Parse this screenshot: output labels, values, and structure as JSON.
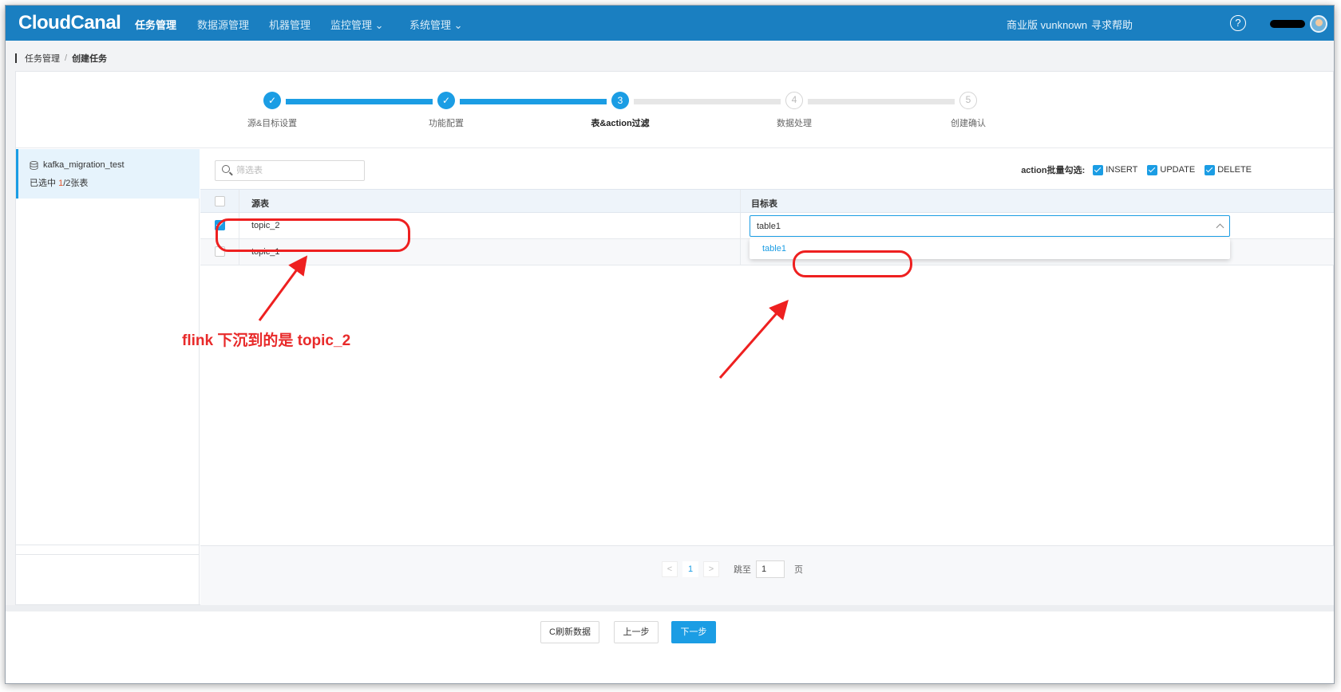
{
  "header": {
    "logo": "CloudCanal",
    "nav": [
      {
        "label": "任务管理",
        "active": true
      },
      {
        "label": "数据源管理",
        "active": false
      },
      {
        "label": "机器管理",
        "active": false
      },
      {
        "label": "监控管理 ⌄",
        "active": false
      },
      {
        "label": "系统管理 ⌄",
        "active": false
      }
    ],
    "edition": "商业版 vunknown",
    "help": "寻求帮助",
    "help_icon_glyph": "?"
  },
  "breadcrumb": {
    "root": "任务管理",
    "sep": "/",
    "current": "创建任务"
  },
  "steps": [
    {
      "label": "源&目标设置",
      "state": "done",
      "glyph": "✓"
    },
    {
      "label": "功能配置",
      "state": "done",
      "glyph": "✓"
    },
    {
      "label": "表&action过滤",
      "state": "current",
      "glyph": "3"
    },
    {
      "label": "数据处理",
      "state": "todo",
      "glyph": "4"
    },
    {
      "label": "创建确认",
      "state": "todo",
      "glyph": "5"
    }
  ],
  "left": {
    "db_name": "kafka_migration_test",
    "selected_prefix": "已选中 ",
    "selected_count": "1",
    "selected_suffix": "/2张表"
  },
  "filter": {
    "placeholder": "筛选表"
  },
  "action_batch": {
    "label": "action批量勾选:",
    "options": [
      "INSERT",
      "UPDATE",
      "DELETE"
    ]
  },
  "table": {
    "headers": {
      "source": "源表",
      "target": "目标表"
    },
    "rows": [
      {
        "source": "topic_2",
        "checked": true,
        "target": "table1"
      },
      {
        "source": "topic_1",
        "checked": false,
        "target": ""
      }
    ],
    "dropdown_option": "table1"
  },
  "pagination": {
    "prev": "<",
    "page": "1",
    "next": ">",
    "jump_label": "跳至",
    "jump_value": "1",
    "page_unit": "页"
  },
  "buttons": {
    "refresh": "C刷新数据",
    "prev": "上一步",
    "next": "下一步"
  },
  "annotation": {
    "text": "flink 下沉到的是 topic_2",
    "color": "#e82a2a"
  },
  "colors": {
    "topbar": "#1a7fc1",
    "accent": "#1b9de4",
    "annotation": "#ee2020"
  }
}
